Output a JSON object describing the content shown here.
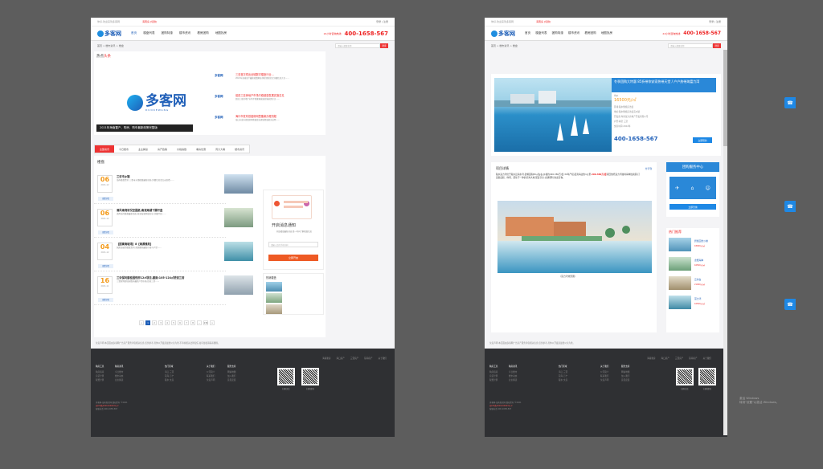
{
  "site": {
    "topbar_left": "你好,欢迎来到多客网",
    "topbar_city": "海南房 [切换]",
    "topbar_login": "登录 | 注册",
    "logo_text": "多客网",
    "nav": [
      "首页",
      "楼盘列表",
      "团购特惠",
      "楼市资讯",
      "看房团购",
      "地图找房"
    ],
    "phone_label": "24小时咨询热线:",
    "phone": "400-1658-567",
    "search_placeholder": "请输入楼盘名称",
    "search_btn": "搜索"
  },
  "left": {
    "breadcrumb": "首页 > 楼市资讯 > 楼盘",
    "hot_title_a": "热点",
    "hot_title_b": "头条",
    "big_logo_cn": "多客网",
    "big_logo_en": "DUOKEWANG",
    "hot_caption": "2021年海南置产、购房、购车最新政策完整版",
    "hot_items": [
      {
        "logo": "多客网",
        "title": "三亚首次闯出全城数字楼盘行业…",
        "desc": "2021年海南房产最新政策解读,购房须知全文详细信息大全……"
      },
      {
        "logo": "多客网",
        "title": "促进三亚房地产市场平稳健康发展实施意见",
        "desc": "促进三亚房地产市场平稳健康发展实施意见全文……"
      },
      {
        "logo": "多客网",
        "title": "海口市发布首套房网签备案办理流程",
        "desc": "海口市发布首套房网签备案办理流程及相关说明……"
      }
    ],
    "tabs": [
      "全部资讯",
      "今日楼市",
      "业主解读",
      "房产政策",
      "价格指数",
      "看房优惠",
      "周大大看",
      "楼市资讯"
    ],
    "section_title": "楼盘",
    "news": [
      {
        "day": "06",
        "ym": "2021-12",
        "more": "查看详情",
        "title": "三亚市乡镇",
        "desc": "海南楼盘资讯:三亚市乡镇楼盘最新动态,详细信息请点击查看……"
      },
      {
        "day": "06",
        "ym": "2021-12",
        "more": "查看详情",
        "title": "清风海湾状况空图纸,南流海湖下脚开盘",
        "desc": "清风海湾楼盘最新动态,南流海湖开盘信息,详细介绍……"
      },
      {
        "day": "04",
        "ym": "2021-12",
        "more": "查看详情",
        "title": "【国寓海城湾】8【海源雅苑】",
        "desc": "国寓海城湾楼盘资讯:海源雅苑最新价格与户型……"
      },
      {
        "day": "16",
        "ym": "2021-11",
        "more": "查看详情",
        "title": "三亚保利碧桂园悦府12#项目,建面:105-124㎡舒适三房",
        "desc": "三亚保利碧桂园悦府最新户型价格,舒适三房……"
      }
    ],
    "pager": [
      "<",
      "1",
      "2",
      "3",
      "4",
      "5",
      "6",
      "7",
      "8",
      "...",
      "236",
      ">"
    ],
    "notify_title": "开启消息通知",
    "notify_desc": "获取楼盘最新动态,第一时间了解楼盘信息",
    "notify_btn": "立即开启",
    "notify_input": "请输入您的手机号码",
    "hot_list_title": "热销楼盘",
    "footer_note": "免责声明:本页面由多客网广告房产服务承包相关信息,仅供参考,具体以开发商最终公示为准,不承担相关法律责任,如有侵权请联系删除。"
  },
  "footer": {
    "links": [
      "海南新房",
      "海口房产",
      "三亚房产",
      "琼海房产",
      "关于我们"
    ],
    "cols": [
      {
        "h": "购房工具",
        "rows": [
          "购房指南",
          "房贷计算",
          "税费计算"
        ]
      },
      {
        "h": "购房资讯",
        "rows": [
          "今日楼市",
          "楼市动态",
          "业主解读"
        ]
      },
      {
        "h": "热门区域",
        "rows": [
          "海口 三亚",
          "琼海 万宁",
          "陵水 文昌"
        ]
      },
      {
        "h": "关于我们",
        "rows": [
          "公司简介",
          "联系我们",
          "免责声明"
        ]
      },
      {
        "h": "服务支持",
        "rows": [
          "网站地图",
          "加入我们",
          "意见反馈"
        ]
      }
    ],
    "qr1": "扫码关注",
    "qr2": "扫码咨询",
    "bottom1": "多客网-海南新房网 版权所有 ©2021",
    "bottom2": "琼ICP备2021000003号-2",
    "bottom3": "客服电话:400-1658-567"
  },
  "right": {
    "promo_head": "冬季团购大特惠 85折带你安家热带天堂 / 户户热带海富力湾",
    "promo_price_label": "均价",
    "promo_price": "16500元/㎡",
    "promo_lines": [
      "区域:陵水黎族自治县",
      "地址:陵水黎族自治县英州镇",
      "开发商:海南富力房地产开发有限公司",
      "户型:两室 三室",
      "交房时间:2022年"
    ],
    "promo_phone": "400-1658-567",
    "promo_btn": "立即预约",
    "article_tag": "项目详情",
    "article_share": "分享到",
    "article_body_1": "陵水富力湾位于陵水县清水湾,建筑面积80㎡左右,价格约290-380万/套,30年产权,距离海边约1公里,",
    "article_highlight": "290-380万/套",
    "article_body_2": "项目依托富力湾独特海岸线资源,打造集度假、休闲、居住于一体的滨海大城,配套齐全,交通便利,欢迎咨询。",
    "article_caption": "(富力湾效果图)",
    "group_center": "团购服务中心",
    "group_icons": [
      "飞机",
      "房子",
      "客服"
    ],
    "group_btn": "立即咨询",
    "hot_rec_title": "热门推荐",
    "rec": [
      {
        "name": "碧桂园金沙滩",
        "price": "18000元/㎡"
      },
      {
        "name": "龙栖海岸",
        "price": "16500元/㎡"
      },
      {
        "name": "云海台",
        "price": "21000元/㎡"
      },
      {
        "name": "富力湾",
        "price": "16500元/㎡"
      }
    ],
    "footer_note": "免责声明:本页面由多客网广告房产服务承包相关信息,仅供参考,具体以开发商最终公示为准。"
  },
  "windows_mark": {
    "line1": "激活 Windows",
    "line2": "转到\"设置\"以激活 Windows。"
  },
  "colors": {
    "brand_blue": "#1f5fb8",
    "accent_red": "#e22222",
    "accent_orange": "#f39a1a",
    "footer_dark": "#2f3033"
  }
}
